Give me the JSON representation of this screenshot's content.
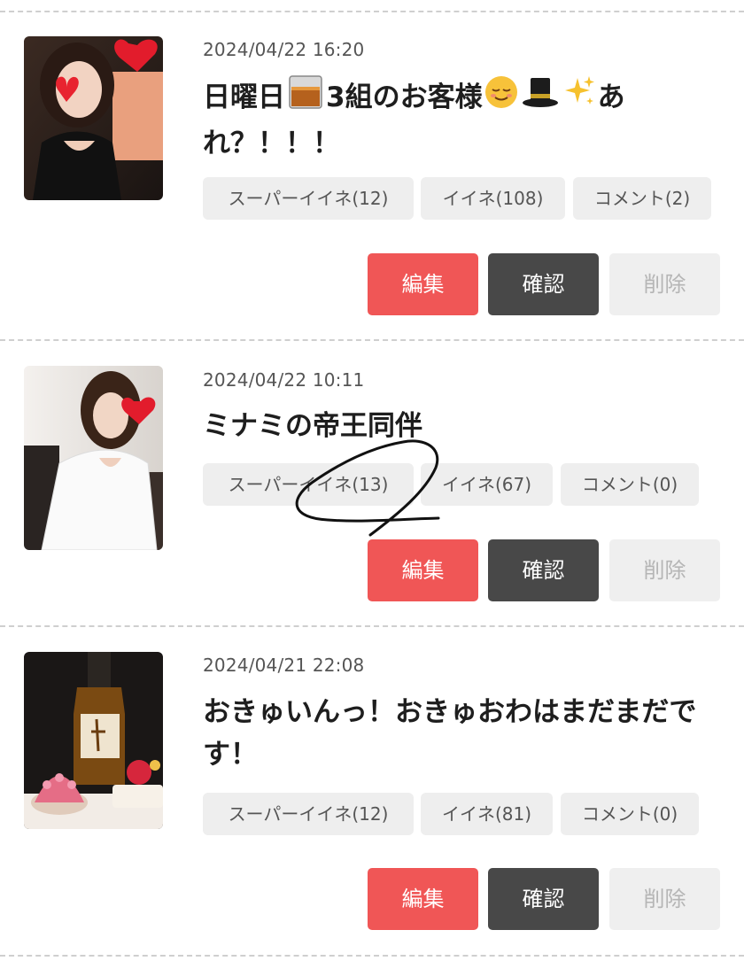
{
  "posts": [
    {
      "date": "2024/04/22 16:20",
      "title_parts": [
        "日曜日",
        "3組のお客様",
        "あれ？！！！"
      ],
      "emojis": [
        "whisky-glass-emoji",
        "relieved-face-emoji",
        "top-hat-emoji",
        "sparkles-emoji"
      ],
      "thumbnail": "photo-of-woman-in-black-dress",
      "tags": {
        "super_like": "スーパーイイネ(12)",
        "like": "イイネ(108)",
        "comment": "コメント(2)"
      },
      "buttons": {
        "edit": "編集",
        "confirm": "確認",
        "delete": "削除"
      }
    },
    {
      "date": "2024/04/22 10:11",
      "title": "ミナミの帝王同伴",
      "thumbnail": "photo-of-woman-in-white-outfit",
      "tags": {
        "super_like": "スーパーイイネ(13)",
        "like": "イイネ(67)",
        "comment": "コメント(0)"
      },
      "buttons": {
        "edit": "編集",
        "confirm": "確認",
        "delete": "削除"
      }
    },
    {
      "date": "2024/04/21 22:08",
      "title": "おきゅいんっ！おきゅおわはまだまだです！",
      "thumbnail": "photo-of-bottle-and-cake",
      "tags": {
        "super_like": "スーパーイイネ(12)",
        "like": "イイネ(81)",
        "comment": "コメント(0)"
      },
      "buttons": {
        "edit": "編集",
        "confirm": "確認",
        "delete": "削除"
      }
    }
  ],
  "colors": {
    "edit_button": "#f05656",
    "confirm_button": "#484848",
    "delete_button": "#efefef",
    "tag_background": "#eeeeee",
    "divider": "#cfcfcf"
  }
}
